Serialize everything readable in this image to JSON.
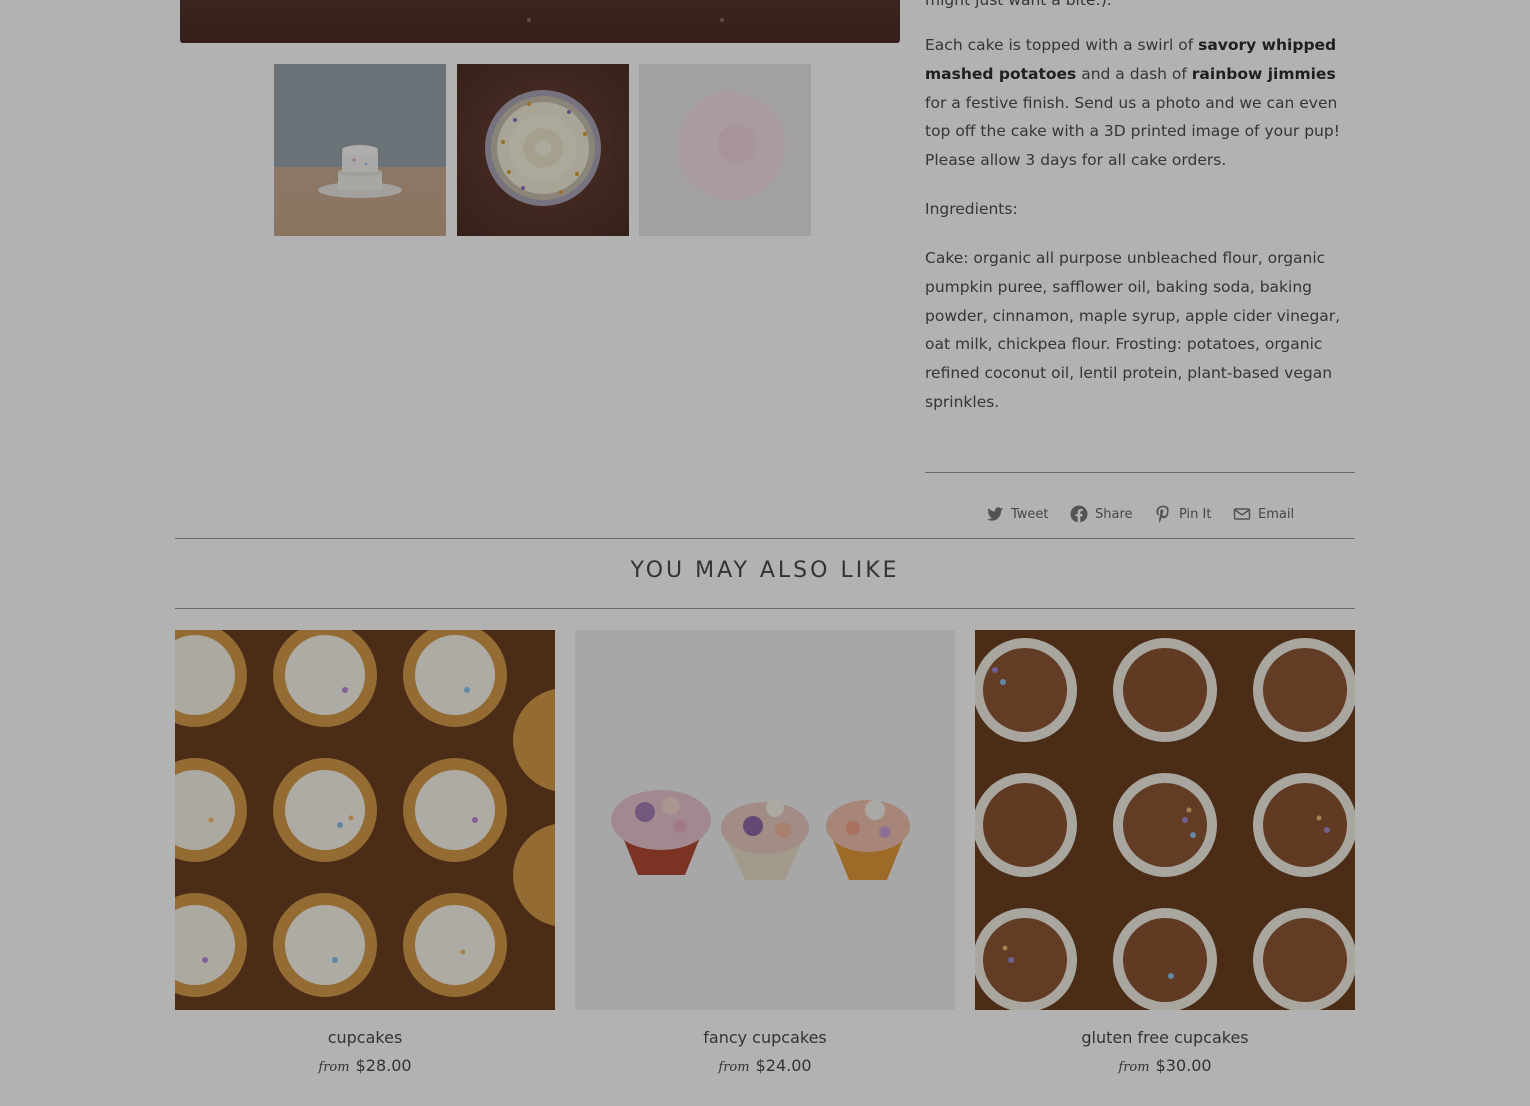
{
  "description": {
    "top_fragment": "might just want a bite:).",
    "paragraph1_prefix": "Each cake is topped with a swirl of ",
    "bold1": "savory whipped mashed potatoes",
    "paragraph1_mid": " and a dash of ",
    "bold2": "rainbow jimmies",
    "paragraph1_suffix": " for a festive finish. Send us a photo and we can even top off the cake with a 3D printed image of your pup! Please allow 3 days for all cake orders.",
    "ingredients_label": "Ingredients:",
    "ingredients_text": "Cake: organic all purpose unbleached flour, organic pumpkin puree, safflower oil, baking soda, baking powder, cinnamon, maple syrup, apple cider vinegar, oat milk, chickpea flour. Frosting: potatoes, organic refined coconut oil, lentil protein, plant-based vegan sprinkles."
  },
  "share": {
    "tweet": "Tweet",
    "share": "Share",
    "pin": "Pin It",
    "email": "Email"
  },
  "related": {
    "title": "YOU MAY ALSO LIKE",
    "products": [
      {
        "name": "cupcakes",
        "from": "from",
        "price": "$28.00"
      },
      {
        "name": "fancy cupcakes",
        "from": "from",
        "price": "$24.00"
      },
      {
        "name": "gluten free cupcakes",
        "from": "from",
        "price": "$30.00"
      }
    ]
  },
  "colors": {
    "overlay": "rgba(0,0,0,0.30)",
    "text": "#4b4b4b"
  }
}
